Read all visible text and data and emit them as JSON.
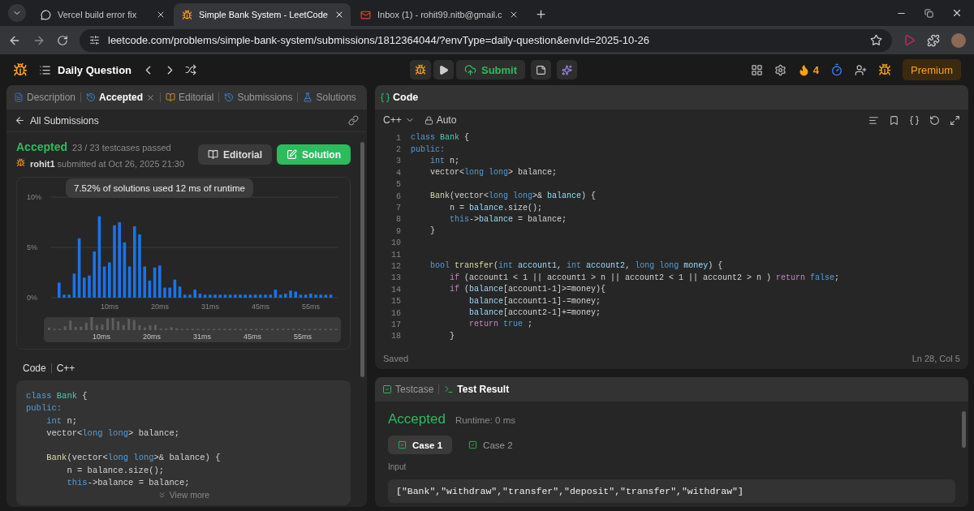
{
  "browser": {
    "tabs": [
      {
        "title": "Vercel build error fix",
        "kind": "chat",
        "selected": false
      },
      {
        "title": "Simple Bank System - LeetCode",
        "kind": "leetcode",
        "selected": true
      },
      {
        "title": "Inbox (1) - rohit99.nitb@gmail.c",
        "kind": "mail",
        "selected": false
      }
    ],
    "address": "leetcode.com/problems/simple-bank-system/submissions/1812364044/?envType=daily-question&envId=2025-10-26"
  },
  "nav": {
    "title": "Daily Question",
    "submit": "Submit",
    "streak": "4",
    "premium": "Premium"
  },
  "left": {
    "tabs": [
      {
        "label": "Description",
        "kind": "description",
        "selected": false,
        "closable": false
      },
      {
        "label": "Accepted",
        "kind": "history",
        "selected": true,
        "closable": true
      },
      {
        "label": "Editorial",
        "kind": "book",
        "selected": false,
        "closable": false
      },
      {
        "label": "Submissions",
        "kind": "history",
        "selected": false,
        "closable": false
      },
      {
        "label": "Solutions",
        "kind": "flask",
        "selected": false,
        "closable": false
      }
    ],
    "back": "All Submissions",
    "status": "Accepted",
    "passed": "23 / 23 testcases passed",
    "user": "rohit1",
    "submitted": "submitted at Oct 26, 2025 21:30",
    "buttons": [
      {
        "label": "Editorial",
        "kind": "secondary"
      },
      {
        "label": "Solution",
        "kind": "primary"
      }
    ],
    "chart": {
      "tooltip": "7.52% of solutions used 12 ms of runtime",
      "overview_labels": [
        "10ms",
        "20ms",
        "31ms",
        "45ms",
        "55ms"
      ],
      "chart_data": {
        "type": "bar",
        "ylim": [
          0,
          10
        ],
        "yticks": [
          {
            "value": 0,
            "label": "0%"
          },
          {
            "value": 5,
            "label": "5%"
          },
          {
            "value": 10,
            "label": "10%"
          }
        ],
        "categories": [
          null,
          null,
          null,
          null,
          null,
          null,
          null,
          null,
          null,
          null,
          "10ms",
          null,
          null,
          null,
          null,
          null,
          null,
          null,
          null,
          null,
          "20ms",
          null,
          null,
          null,
          null,
          null,
          null,
          null,
          null,
          null,
          "31ms",
          null,
          null,
          null,
          null,
          null,
          null,
          null,
          null,
          null,
          "45ms",
          null,
          null,
          null,
          null,
          null,
          null,
          null,
          null,
          null,
          "55ms",
          null,
          null,
          null,
          null
        ],
        "series": [
          {
            "color": "#1a73e8",
            "values": [
              1.5,
              0.3,
              0.3,
              2.4,
              5.9,
              2.0,
              2.2,
              4.6,
              8.1,
              3.1,
              3.5,
              7.2,
              7.5,
              5.5,
              3.1,
              7.1,
              6.3,
              3.1,
              1.7,
              3.0,
              3.2,
              1.0,
              1.0,
              1.8,
              1.1,
              0.3,
              0.3,
              0.8,
              0.4,
              0.3,
              0.3,
              0.3,
              0.3,
              0.3,
              0.3,
              0.3,
              0.3,
              0.3,
              0.3,
              0.3,
              0.3,
              0.3,
              0.3,
              0.8,
              0.3,
              0.4,
              0.7,
              0.6,
              0.3,
              0.3,
              0.4,
              0.3,
              0.3,
              0.3,
              0.3
            ]
          }
        ]
      }
    },
    "code_label": "Code",
    "language": "C++",
    "code": [
      {
        "tokens": [
          {
            "text": "class ",
            "kind": "keyword"
          },
          {
            "text": "Bank",
            "kind": "type"
          },
          {
            "text": " {",
            "kind": "plain"
          }
        ]
      },
      {
        "tokens": [
          {
            "text": "public:",
            "kind": "keyword"
          }
        ]
      },
      {
        "tokens": [
          {
            "text": "    int ",
            "kind": "keyword"
          },
          {
            "text": "n;",
            "kind": "plain"
          }
        ]
      },
      {
        "tokens": [
          {
            "text": "    vector<",
            "kind": "plain"
          },
          {
            "text": "long long",
            "kind": "keyword"
          },
          {
            "text": "> balance;",
            "kind": "plain"
          }
        ]
      },
      {
        "blank": true
      },
      {
        "tokens": [
          {
            "text": "    Bank",
            "kind": "function"
          },
          {
            "text": "(vector<",
            "kind": "plain"
          },
          {
            "text": "long long",
            "kind": "keyword"
          },
          {
            "text": ">& balance) {",
            "kind": "plain"
          }
        ]
      },
      {
        "tokens": [
          {
            "text": "        n = balance.size();",
            "kind": "plain"
          }
        ]
      },
      {
        "tokens": [
          {
            "text": "        this",
            "kind": "keyword"
          },
          {
            "text": "->balance = balance;",
            "kind": "plain"
          }
        ]
      }
    ],
    "view_more": "View more"
  },
  "editor": {
    "title": "Code",
    "language": "C++",
    "mode": "Auto",
    "status": "Saved",
    "cursor": "Ln 28, Col 5",
    "lines": [
      {
        "n": "1",
        "code": [
          {
            "text": "class ",
            "kind": "keyword"
          },
          {
            "text": "Bank",
            "kind": "type"
          },
          {
            "text": " {",
            "kind": "plain"
          }
        ]
      },
      {
        "n": "2",
        "code": [
          {
            "text": "public:",
            "kind": "keyword"
          }
        ]
      },
      {
        "n": "3",
        "code": [
          {
            "text": "    int ",
            "kind": "keyword"
          },
          {
            "text": "n;",
            "kind": "plain"
          }
        ]
      },
      {
        "n": "4",
        "code": [
          {
            "text": "    vector<",
            "kind": "plain"
          },
          {
            "text": "long long",
            "kind": "keyword"
          },
          {
            "text": "> balance;",
            "kind": "plain"
          }
        ]
      },
      {
        "n": "5"
      },
      {
        "n": "6",
        "code": [
          {
            "text": "    Bank",
            "kind": "function"
          },
          {
            "text": "(vector<",
            "kind": "plain"
          },
          {
            "text": "long long",
            "kind": "keyword"
          },
          {
            "text": ">& ",
            "kind": "plain"
          },
          {
            "text": "balance",
            "kind": "variable"
          },
          {
            "text": ") {",
            "kind": "plain"
          }
        ]
      },
      {
        "n": "7",
        "code": [
          {
            "text": "        n = ",
            "kind": "plain"
          },
          {
            "text": "balance",
            "kind": "variable"
          },
          {
            "text": ".size();",
            "kind": "plain"
          }
        ]
      },
      {
        "n": "8",
        "code": [
          {
            "text": "        this",
            "kind": "keyword"
          },
          {
            "text": "->",
            "kind": "plain"
          },
          {
            "text": "balance",
            "kind": "variable"
          },
          {
            "text": " = balance;",
            "kind": "plain"
          }
        ]
      },
      {
        "n": "9",
        "code": [
          {
            "text": "    }",
            "kind": "plain"
          }
        ]
      },
      {
        "n": "10"
      },
      {
        "n": "11"
      },
      {
        "n": "12",
        "code": [
          {
            "text": "    bool ",
            "kind": "keyword"
          },
          {
            "text": "transfer",
            "kind": "function"
          },
          {
            "text": "(",
            "kind": "plain"
          },
          {
            "text": "int ",
            "kind": "keyword"
          },
          {
            "text": "account1",
            "kind": "variable"
          },
          {
            "text": ", ",
            "kind": "plain"
          },
          {
            "text": "int ",
            "kind": "keyword"
          },
          {
            "text": "account2",
            "kind": "variable"
          },
          {
            "text": ", ",
            "kind": "plain"
          },
          {
            "text": "long long ",
            "kind": "keyword"
          },
          {
            "text": "money",
            "kind": "variable"
          },
          {
            "text": ") {",
            "kind": "plain"
          }
        ]
      },
      {
        "n": "13",
        "code": [
          {
            "text": "        if ",
            "kind": "control"
          },
          {
            "text": "(account1 < 1 || account1 > n || account2 < 1 || account2 > n ) ",
            "kind": "plain"
          },
          {
            "text": "return ",
            "kind": "control"
          },
          {
            "text": "false",
            "kind": "keyword"
          },
          {
            "text": ";",
            "kind": "plain"
          }
        ]
      },
      {
        "n": "14",
        "code": [
          {
            "text": "        if ",
            "kind": "control"
          },
          {
            "text": "(",
            "kind": "plain"
          },
          {
            "text": "balance",
            "kind": "variable"
          },
          {
            "text": "[account1-1]>=money){",
            "kind": "plain"
          }
        ]
      },
      {
        "n": "15",
        "code": [
          {
            "text": "            balance",
            "kind": "variable"
          },
          {
            "text": "[account1-1]-=money;",
            "kind": "plain"
          }
        ]
      },
      {
        "n": "16",
        "code": [
          {
            "text": "            balance",
            "kind": "variable"
          },
          {
            "text": "[account2-1]+=money;",
            "kind": "plain"
          }
        ]
      },
      {
        "n": "17",
        "code": [
          {
            "text": "            return ",
            "kind": "control"
          },
          {
            "text": "true",
            "kind": "keyword"
          },
          {
            "text": " ;",
            "kind": "plain"
          }
        ]
      },
      {
        "n": "18",
        "code": [
          {
            "text": "        }",
            "kind": "plain"
          }
        ]
      }
    ]
  },
  "result": {
    "tabs": [
      {
        "label": "Testcase",
        "kind": "check",
        "selected": false
      },
      {
        "label": "Test Result",
        "kind": "terminal",
        "selected": true
      }
    ],
    "status": "Accepted",
    "runtime": "Runtime: 0 ms",
    "cases": [
      {
        "label": "Case 1",
        "selected": true,
        "passed": true
      },
      {
        "label": "Case 2",
        "selected": false,
        "passed": true
      }
    ],
    "input_label": "Input",
    "input": "[\"Bank\",\"withdraw\",\"transfer\",\"deposit\",\"transfer\",\"withdraw\"]"
  }
}
